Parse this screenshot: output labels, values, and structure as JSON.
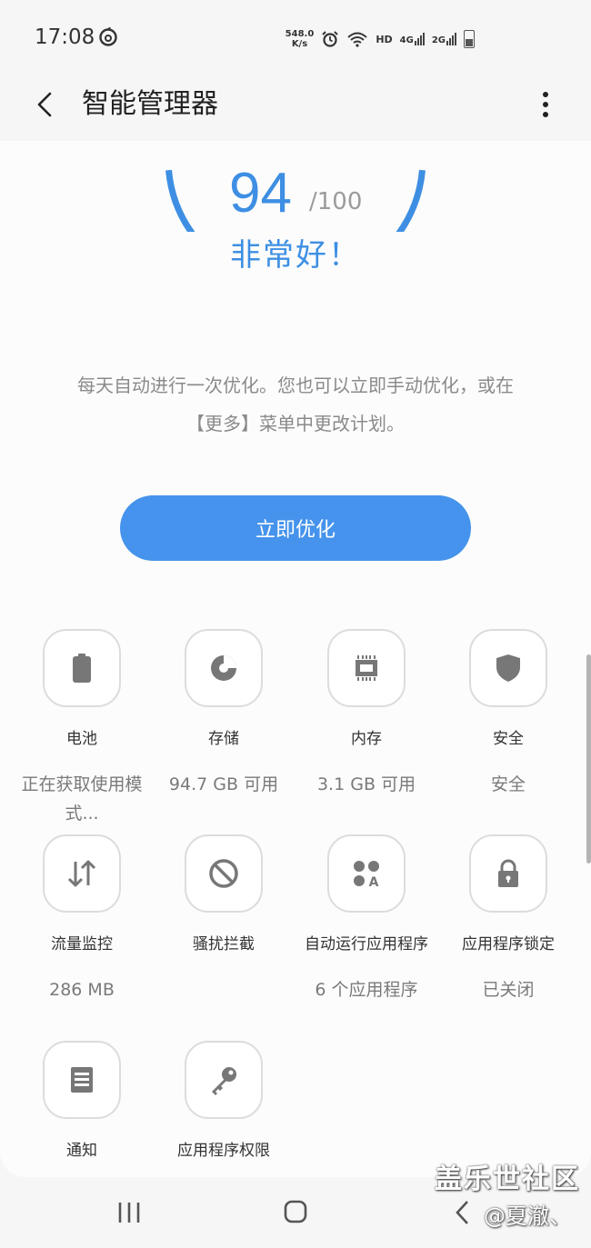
{
  "status_bar": {
    "time": "17:08",
    "net_speed_value": "548.0",
    "net_speed_unit": "K/s",
    "hd": "HD",
    "sim1": "4G",
    "sim2": "2G"
  },
  "header": {
    "title": "智能管理器"
  },
  "score": {
    "value": "94",
    "max": "/100",
    "status": "非常好！",
    "fraction": 0.94,
    "accent": "#3e8fe3"
  },
  "description": {
    "line1": "每天自动进行一次优化。您也可以立即手动优化，或在",
    "line2": "【更多】菜单中更改计划。"
  },
  "optimize_button": {
    "label": "立即优化",
    "color": "#4593ec"
  },
  "tiles": [
    {
      "icon": "battery-icon",
      "label": "电池",
      "value": "正在获取使用模式..."
    },
    {
      "icon": "storage-pie-icon",
      "label": "存储",
      "value": "94.7 GB 可用"
    },
    {
      "icon": "memory-chip-icon",
      "label": "内存",
      "value": "3.1 GB 可用"
    },
    {
      "icon": "shield-icon",
      "label": "安全",
      "value": "安全"
    },
    {
      "icon": "data-transfer-icon",
      "label": "流量监控",
      "value": "286 MB"
    },
    {
      "icon": "block-icon",
      "label": "骚扰拦截",
      "value": ""
    },
    {
      "icon": "auto-run-apps-icon",
      "label": "自动运行应用程序",
      "value": "6 个应用程序"
    },
    {
      "icon": "lock-icon",
      "label": "应用程序锁定",
      "value": "已关闭"
    },
    {
      "icon": "notification-list-icon",
      "label": "通知",
      "value": ""
    },
    {
      "icon": "key-icon",
      "label": "应用程序权限",
      "value": ""
    }
  ],
  "watermark": {
    "brand": "盖乐世社区",
    "user": "@夏澈、"
  }
}
